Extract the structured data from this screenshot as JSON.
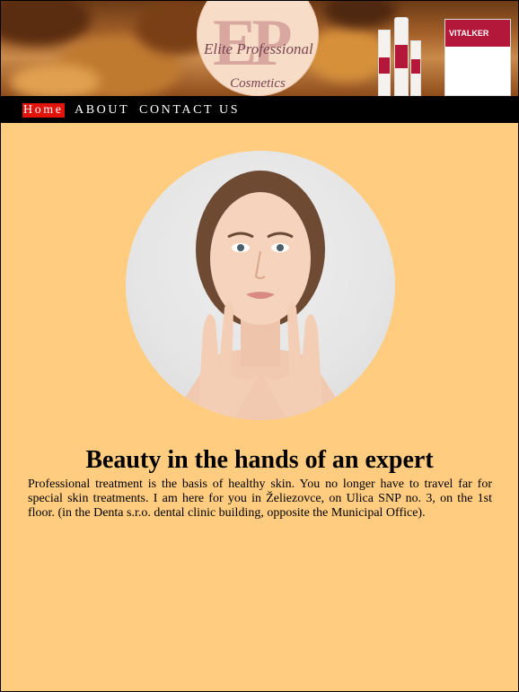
{
  "header": {
    "logo_monogram": "EP",
    "logo_line1": "Elite Professional",
    "logo_line2": "Cosmetics",
    "product_brand": "VITALKER"
  },
  "nav": {
    "items": [
      {
        "label": "Home",
        "active": true
      },
      {
        "label": "ABOUT",
        "active": false
      },
      {
        "label": "CONTACT US",
        "active": false
      }
    ]
  },
  "main": {
    "headline": "Beauty in the hands of an expert",
    "body": "Professional treatment is the basis of healthy skin. You no longer have to travel far for special skin treatments. I am here for you in Želiezovce, on Ulica SNP no. 3, on the 1st floor. (in the Denta s.r.o. dental clinic building, opposite the Municipal Office)."
  },
  "colors": {
    "page_background": "#ffcc80",
    "nav_background": "#000000",
    "nav_active": "#e2140c",
    "brand_red": "#b3173a"
  }
}
